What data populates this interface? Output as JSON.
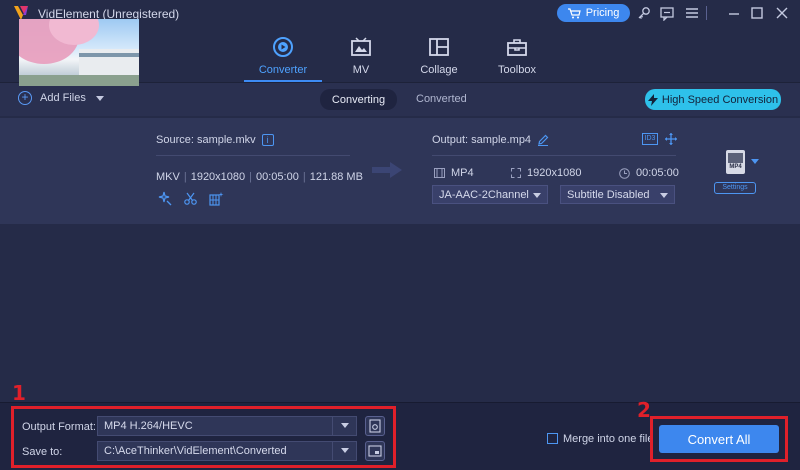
{
  "titlebar": {
    "title": "VidElement (Unregistered)",
    "pricing_label": "Pricing",
    "icons": [
      "cart-icon",
      "key-icon",
      "chat-icon",
      "menu-icon",
      "minimize-icon",
      "maximize-icon",
      "close-icon"
    ]
  },
  "nav": {
    "tabs": [
      {
        "label": "Converter",
        "icon": "converter-icon",
        "active": true
      },
      {
        "label": "MV",
        "icon": "mv-icon",
        "active": false
      },
      {
        "label": "Collage",
        "icon": "collage-icon",
        "active": false
      },
      {
        "label": "Toolbox",
        "icon": "toolbox-icon",
        "active": false
      }
    ]
  },
  "toolbar": {
    "add_files_label": "Add Files",
    "tab_converting": "Converting",
    "tab_converted": "Converted",
    "high_speed_label": "High Speed Conversion"
  },
  "file": {
    "source_label": "Source: sample.mkv",
    "format": "MKV",
    "resolution": "1920x1080",
    "duration": "00:05:00",
    "size": "121.88 MB",
    "output_label": "Output: sample.mp4",
    "out_format": "MP4",
    "out_resolution": "1920x1080",
    "out_duration": "00:05:00",
    "audio_track": "JA-AAC-2Channel",
    "subtitle": "Subtitle Disabled",
    "format_icon_text": "MP4",
    "settings_label": "Settings"
  },
  "bottom": {
    "output_format_label": "Output Format:",
    "output_format_value": "MP4 H.264/HEVC",
    "save_to_label": "Save to:",
    "save_to_value": "C:\\AceThinker\\VidElement\\Converted",
    "merge_label": "Merge into one file",
    "convert_all_label": "Convert All"
  },
  "annotations": {
    "marker_1": "1",
    "marker_2": "2",
    "color": "#e0202a"
  },
  "colors": {
    "accent": "#3d87ee",
    "high_speed": "#2ec1ea",
    "background": "#252b48"
  }
}
